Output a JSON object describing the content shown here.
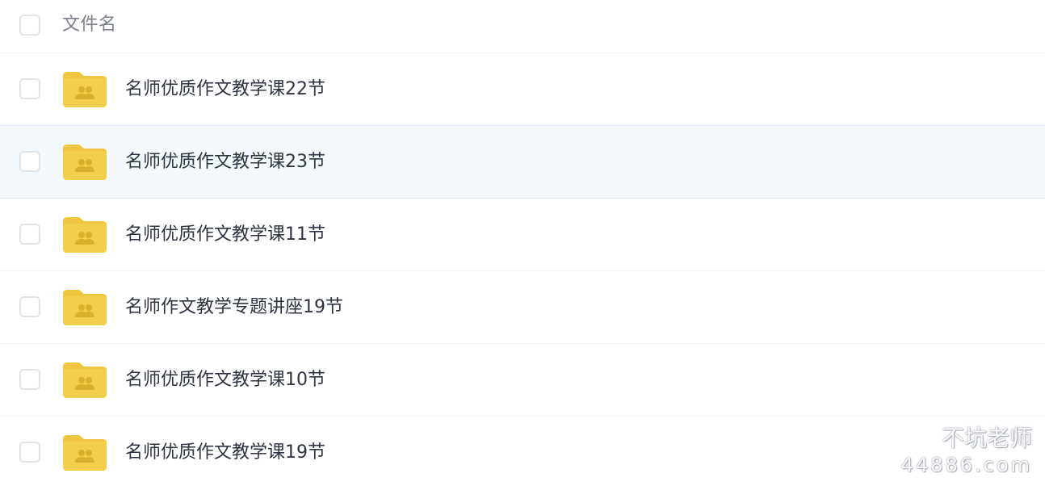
{
  "header": {
    "column_label": "文件名"
  },
  "files": [
    {
      "name": "名师优质作文教学课22节",
      "selected": false
    },
    {
      "name": "名师优质作文教学课23节",
      "selected": true
    },
    {
      "name": "名师优质作文教学课11节",
      "selected": false
    },
    {
      "name": "名师作文教学专题讲座19节",
      "selected": false
    },
    {
      "name": "名师优质作文教学课10节",
      "selected": false
    },
    {
      "name": "名师优质作文教学课19节",
      "selected": false
    }
  ],
  "watermark": {
    "title": "不坑老师",
    "site": "44886.com"
  },
  "icons": {
    "folder": "shared-folder-icon",
    "watermark": "wechat-icon"
  },
  "colors": {
    "folder": "#f2cf4a",
    "folder_tab": "#eec63f",
    "people": "#d9b22c",
    "selected_row": "#f4f9fe"
  }
}
